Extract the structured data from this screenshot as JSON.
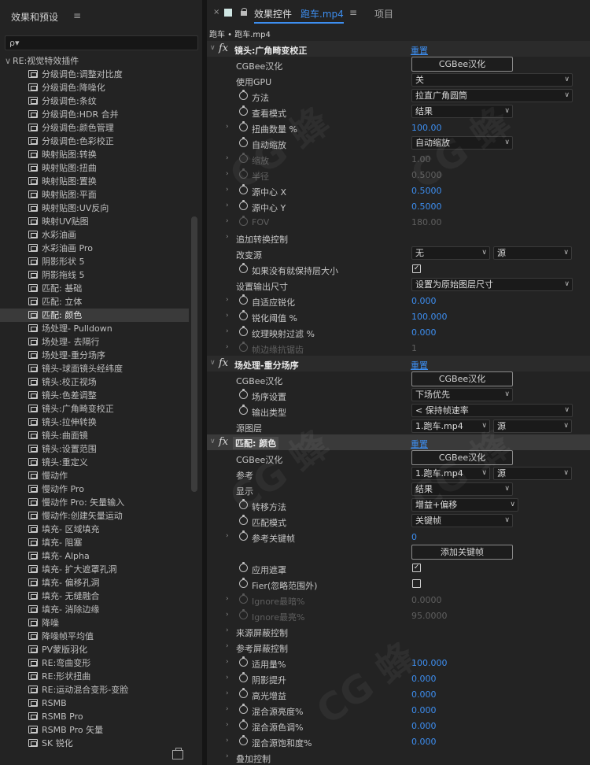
{
  "left_panel": {
    "title": "效果和预设",
    "menu_glyph": "≡",
    "search_glyph": "ρ▾",
    "group": {
      "chevron": "∨",
      "label": "RE:视觉特效插件"
    },
    "items": [
      "分级调色:调整对比度",
      "分级调色:降噪化",
      "分级调色:条纹",
      "分级调色:HDR 合并",
      "分级调色:颜色管理",
      "分级调色:色彩校正",
      "映射贴图:转换",
      "映射贴图:扭曲",
      "映射贴图:置换",
      "映射贴图:平面",
      "映射贴图:UV反向",
      "映射UV贴图",
      "水彩油画",
      "水彩油画 Pro",
      "阴影形状 5",
      "阴影拖线 5",
      "匹配: 基础",
      "匹配: 立体",
      "匹配: 颜色",
      "场处理- Pulldown",
      "场处理- 去隔行",
      "场处理-重分场序",
      "镜头-球面镜头经纬度",
      "镜头:校正视场",
      "镜头:色差调整",
      "镜头:广角畸变校正",
      "镜头:拉伸转换",
      "镜头:曲面镜",
      "镜头:设置范围",
      "镜头:重定义",
      "慢动作",
      "慢动作 Pro",
      "慢动作 Pro: 矢量输入",
      "慢动作:创建矢量运动",
      "填充- 区域填充",
      "填充- 阻塞",
      "填充- Alpha",
      "填充- 扩大遮罩孔洞",
      "填充- 偏移孔洞",
      "填充- 无缝融合",
      "填充- 消除边缘",
      "降噪",
      "降噪帧平均值",
      "PV蒙版羽化",
      "RE:弯曲变形",
      "RE:形状扭曲",
      "RE:运动混合变形-变脸",
      "RSMB",
      "RSMB Pro",
      "RSMB Pro 矢量",
      "SK 锐化"
    ],
    "selected_index": 18
  },
  "right_panel": {
    "close_glyph": "×",
    "tab_label": "效果控件",
    "tab_clip": "跑车.mp4",
    "tab_menu_glyph": "≡",
    "tab_project": "项目",
    "breadcrumb": "跑车 • 跑车.mp4",
    "rows": [
      {
        "type": "fx",
        "name": "镜头:广角畸变校正",
        "reset": "重置"
      },
      {
        "type": "btn",
        "name": "CGBee汉化",
        "button": "CGBee汉化"
      },
      {
        "type": "dd",
        "name": "使用GPU",
        "options": [
          {
            "text": "关",
            "w": 205
          }
        ]
      },
      {
        "type": "dd",
        "name": "方法",
        "sw": true,
        "options": [
          {
            "text": "拉直广角圆筒",
            "w": 205
          }
        ]
      },
      {
        "type": "dd",
        "name": "查看模式",
        "sw": true,
        "options": [
          {
            "text": "结果",
            "w": 129
          }
        ]
      },
      {
        "type": "val",
        "name": "扭曲数量 %",
        "sw": true,
        "tw": true,
        "value": "100.00"
      },
      {
        "type": "dd",
        "name": "自动缩放",
        "sw": true,
        "options": [
          {
            "text": "自动缩放",
            "w": 129
          }
        ]
      },
      {
        "type": "val",
        "name": "缩放",
        "sw": true,
        "tw": true,
        "value": "1.00",
        "disabled": true
      },
      {
        "type": "val",
        "name": "半径",
        "sw": true,
        "tw": true,
        "value": "0.5000",
        "disabled": true
      },
      {
        "type": "val",
        "name": "源中心 X",
        "sw": true,
        "tw": true,
        "value": "0.5000"
      },
      {
        "type": "val",
        "name": "源中心 Y",
        "sw": true,
        "tw": true,
        "value": "0.5000"
      },
      {
        "type": "val",
        "name": "FOV",
        "sw": true,
        "tw": true,
        "value": "180.00",
        "disabled": true
      },
      {
        "type": "label",
        "name": "追加转换控制",
        "tw": true
      },
      {
        "type": "dd",
        "name": "改变源",
        "options": [
          {
            "text": "无",
            "w": 100
          },
          {
            "text": "源",
            "w": 100
          }
        ]
      },
      {
        "type": "cb",
        "name": "如果没有就保持层大小",
        "sw": true,
        "checked": true
      },
      {
        "type": "dd",
        "name": "设置输出尺寸",
        "options": [
          {
            "text": "设置为原始图层尺寸",
            "w": 205
          }
        ]
      },
      {
        "type": "val",
        "name": "自适应锐化",
        "sw": true,
        "tw": true,
        "value": "0.000"
      },
      {
        "type": "val",
        "name": "锐化阈值 %",
        "sw": true,
        "tw": true,
        "value": "100.000"
      },
      {
        "type": "val",
        "name": "纹理映射过滤 %",
        "sw": true,
        "tw": true,
        "value": "0.000"
      },
      {
        "type": "val",
        "name": "帧边缘抗锯齿",
        "sw": true,
        "tw": true,
        "value": "1",
        "disabled": true
      },
      {
        "type": "fx",
        "name": "场处理-重分场序",
        "reset": "重置"
      },
      {
        "type": "btn",
        "name": "CGBee汉化",
        "button": "CGBee汉化"
      },
      {
        "type": "dd",
        "name": "场序设置",
        "sw": true,
        "options": [
          {
            "text": "下场优先",
            "w": 129
          }
        ]
      },
      {
        "type": "dd",
        "name": "输出类型",
        "sw": true,
        "options": [
          {
            "text": "< 保持帧速率",
            "w": 205
          }
        ]
      },
      {
        "type": "dd",
        "name": "源图层",
        "options": [
          {
            "text": "1.跑车.mp4",
            "w": 100
          },
          {
            "text": "源",
            "w": 100
          }
        ]
      },
      {
        "type": "fx",
        "name": "匹配: 颜色",
        "reset": "重置",
        "selected": true
      },
      {
        "type": "btn",
        "name": "CGBee汉化",
        "button": "CGBee汉化"
      },
      {
        "type": "dd",
        "name": "参考",
        "options": [
          {
            "text": "1.跑车.mp4",
            "w": 100
          },
          {
            "text": "源",
            "w": 100
          }
        ]
      },
      {
        "type": "dd",
        "name": "显示",
        "options": [
          {
            "text": "结果",
            "w": 129
          }
        ]
      },
      {
        "type": "dd",
        "name": "转移方法",
        "sw": true,
        "options": [
          {
            "text": "增益+偏移",
            "w": 136
          }
        ]
      },
      {
        "type": "dd",
        "name": "匹配模式",
        "sw": true,
        "options": [
          {
            "text": "关键帧",
            "w": 129
          }
        ]
      },
      {
        "type": "val",
        "name": "参考关键帧",
        "sw": true,
        "tw": true,
        "value": "0"
      },
      {
        "type": "btn",
        "name": "",
        "button": "添加关键帧"
      },
      {
        "type": "cb",
        "name": "应用遮罩",
        "sw": true,
        "checked": true
      },
      {
        "type": "cb",
        "name": "Fier(忽略范围外)",
        "sw": true,
        "checked": false
      },
      {
        "type": "val",
        "name": "Ignore最暗%",
        "sw": true,
        "tw": true,
        "value": "0.0000",
        "disabled": true
      },
      {
        "type": "val",
        "name": "Ignore最亮%",
        "sw": true,
        "tw": true,
        "value": "95.0000",
        "disabled": true
      },
      {
        "type": "label",
        "name": "来源屏蔽控制",
        "tw": true
      },
      {
        "type": "label",
        "name": "参考屏蔽控制",
        "tw": true
      },
      {
        "type": "val",
        "name": "适用量%",
        "sw": true,
        "tw": true,
        "value": "100.000"
      },
      {
        "type": "val",
        "name": "阴影提升",
        "sw": true,
        "tw": true,
        "value": "0.000"
      },
      {
        "type": "val",
        "name": "高光增益",
        "sw": true,
        "tw": true,
        "value": "0.000"
      },
      {
        "type": "val",
        "name": "混合源亮度%",
        "sw": true,
        "tw": true,
        "value": "0.000"
      },
      {
        "type": "val",
        "name": "混合源色调%",
        "sw": true,
        "tw": true,
        "value": "0.000"
      },
      {
        "type": "val",
        "name": "混合源饱和度%",
        "sw": true,
        "tw": true,
        "value": "0.000"
      },
      {
        "type": "label",
        "name": "叠加控制",
        "tw": true
      }
    ]
  },
  "watermark": "CG 蜂",
  "colors": {
    "accent": "#3d8ef0",
    "panel": "#232323",
    "selected": "#3a3a3a"
  }
}
